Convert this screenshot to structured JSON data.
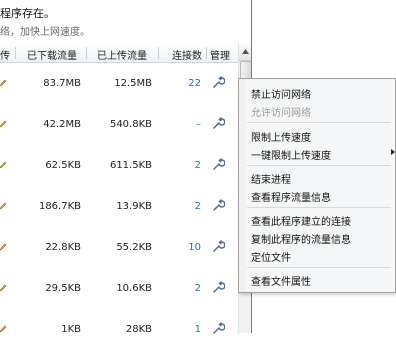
{
  "notice": {
    "title": "程序存在。",
    "subtitle": "络，加快上网速度。"
  },
  "table": {
    "headers": [
      "传",
      "已下载流量",
      "已上传流量",
      "连接数",
      "管理"
    ],
    "rows": [
      {
        "downloaded": "83.7MB",
        "uploaded": "12.5MB",
        "connections": "22"
      },
      {
        "downloaded": "42.2MB",
        "uploaded": "540.8KB",
        "connections": "–"
      },
      {
        "downloaded": "62.5KB",
        "uploaded": "611.5KB",
        "connections": "2"
      },
      {
        "downloaded": "186.7KB",
        "uploaded": "13.9KB",
        "connections": "2"
      },
      {
        "downloaded": "22.8KB",
        "uploaded": "55.2KB",
        "connections": "10"
      },
      {
        "downloaded": "29.5KB",
        "uploaded": "10.6KB",
        "connections": "2"
      },
      {
        "downloaded": "1KB",
        "uploaded": "28KB",
        "connections": "1"
      }
    ]
  },
  "context_menu": {
    "items": [
      {
        "label": "禁止访问网络",
        "enabled": true
      },
      {
        "label": "允许访问网络",
        "enabled": false
      },
      {
        "label": "限制上传速度",
        "enabled": true
      },
      {
        "label": "一键限制上传速度",
        "enabled": true,
        "submenu": true
      },
      {
        "label": "结束进程",
        "enabled": true
      },
      {
        "label": "查看程序流量信息",
        "enabled": true
      },
      {
        "label": "查看此程序建立的连接",
        "enabled": true
      },
      {
        "label": "复制此程序的流量信息",
        "enabled": true
      },
      {
        "label": "定位文件",
        "enabled": true
      },
      {
        "label": "查看文件属性",
        "enabled": true
      }
    ]
  },
  "colors": {
    "accent": "#1e73c8",
    "divider": "#3f86d5"
  },
  "icons": {
    "row_edit": "pen-icon",
    "row_manage": "wrench-icon",
    "submenu": "chevron-right-icon",
    "scroll_up": "chevron-up-icon"
  }
}
